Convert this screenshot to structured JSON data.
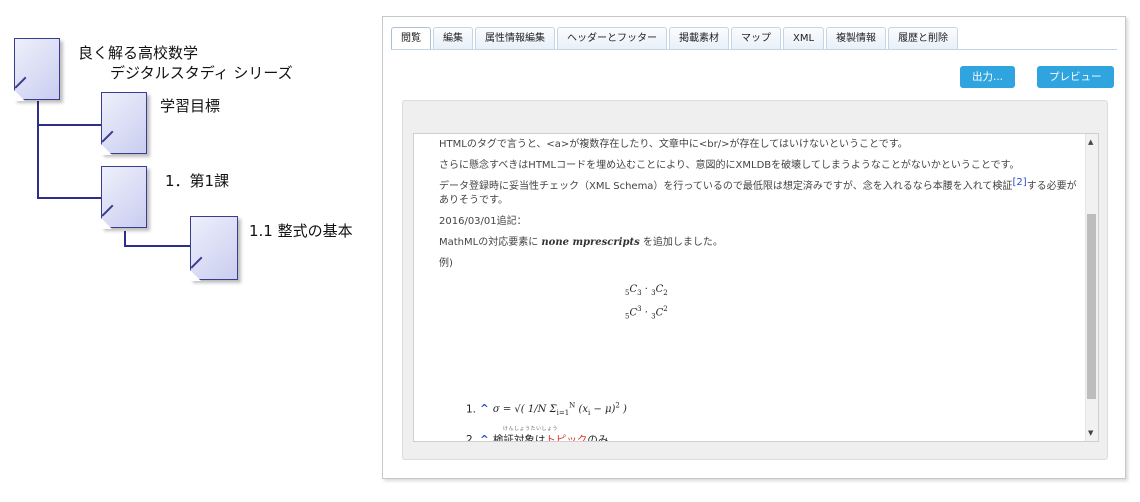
{
  "tree": {
    "root_title_line1": "良く解る高校数学",
    "root_title_line2": "デジタルスタディ シリーズ",
    "node1": "学習目標",
    "node2": "1．第1課",
    "node3": "1.1 整式の基本"
  },
  "tabs": [
    {
      "label": "閲覧",
      "active": true
    },
    {
      "label": "編集"
    },
    {
      "label": "属性情報編集"
    },
    {
      "label": "ヘッダーとフッター"
    },
    {
      "label": "掲載素材"
    },
    {
      "label": "マップ"
    },
    {
      "label": "XML"
    },
    {
      "label": "複製情報"
    },
    {
      "label": "履歴と削除"
    }
  ],
  "buttons": {
    "output": "出力...",
    "preview": "プレビュー"
  },
  "content": {
    "p1": "HTMLのタグで言うと、<a>が複数存在したり、文章中に<br/>が存在してはいけないということです。",
    "p2": "さらに懸念すべきはHTMLコードを埋め込むことにより、意図的にXMLDBを破壊してしまうようなことがないかということです。",
    "p3a": "データ登録時に妥当性チェック（XML Schema）を行っているので最低限は想定済みですが、念を入れるなら本腰を入れて検証",
    "p3ref": "[2]",
    "p3b": "する必要がありそうです。",
    "p4": "2016/03/01追記：",
    "p5a": "MathMLの対応要素に ",
    "p5code": "none mprescripts",
    "p5b": " を追加しました。",
    "p6": "例)",
    "fn1_num": "1.",
    "fn1_caret": "^",
    "fn2_num": "2.",
    "fn2_caret": "^",
    "fn2_ruby": "けんしょうたいしょう",
    "fn2_a": "検証対象は",
    "fn2_topic": "トピック",
    "fn2_b": "のみ"
  },
  "colors": {
    "button": "#2fa4de",
    "tree_line": "#2e2e8a",
    "topic": "#e0322b",
    "link": "#2a4bd1"
  },
  "scroll": {
    "up_icon": "triangle-up",
    "down_icon": "triangle-down"
  }
}
